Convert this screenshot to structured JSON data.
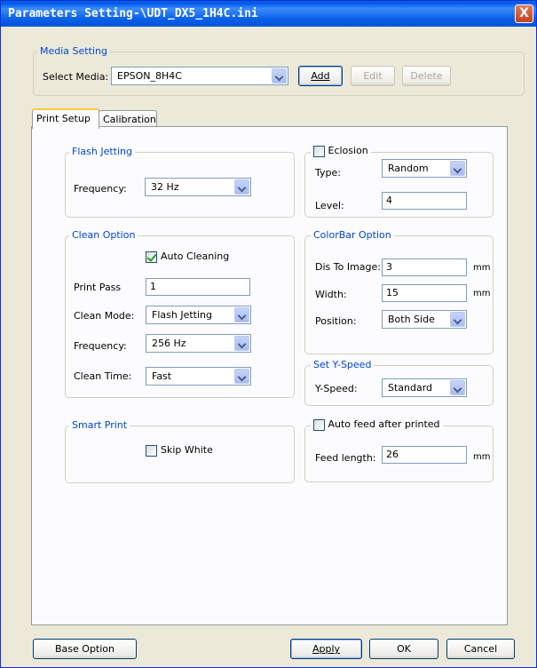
{
  "window": {
    "title": "Parameters Setting-\\UDT_DX5_1H4C.ini",
    "close_label": "X"
  },
  "media_setting": {
    "legend": "Media Setting",
    "select_label": "Select Media:",
    "selected_media": "EPSON_8H4C",
    "add_label": "Add",
    "edit_label": "Edit",
    "delete_label": "Delete"
  },
  "tabs": [
    {
      "label": "Print Setup",
      "active": true
    },
    {
      "label": "Calibration",
      "active": false
    }
  ],
  "flash_jetting": {
    "legend": "Flash Jetting",
    "frequency_label": "Frequency:",
    "frequency_value": "32   Hz"
  },
  "eclosion": {
    "label": "Eclosion",
    "checked": false,
    "type_label": "Type:",
    "type_value": "Random",
    "level_label": "Level:",
    "level_value": "4"
  },
  "clean_option": {
    "legend": "Clean Option",
    "auto_cleaning_label": "Auto Cleaning",
    "auto_cleaning_checked": true,
    "print_pass_label": "Print Pass",
    "print_pass_value": "1",
    "clean_mode_label": "Clean Mode:",
    "clean_mode_value": "Flash Jetting",
    "frequency_label": "Frequency:",
    "frequency_value": "256  Hz",
    "clean_time_label": "Clean Time:",
    "clean_time_value": "Fast"
  },
  "colorbar_option": {
    "legend": "ColorBar Option",
    "dis_label": "Dis To Image:",
    "dis_value": "3",
    "dis_unit": "mm",
    "width_label": "Width:",
    "width_value": "15",
    "width_unit": "mm",
    "position_label": "Position:",
    "position_value": "Both Side"
  },
  "y_speed": {
    "legend": "Set Y-Speed",
    "label": "Y-Speed:",
    "value": "Standard"
  },
  "smart_print": {
    "legend": "Smart Print",
    "skip_white_label": "Skip White",
    "skip_white_checked": false
  },
  "auto_feed": {
    "label": "Auto feed after printed",
    "checked": false,
    "feed_length_label": "Feed length:",
    "feed_length_value": "26",
    "unit": "mm"
  },
  "footer": {
    "base_option_label": "Base Option",
    "apply_label": "Apply",
    "ok_label": "OK",
    "cancel_label": "Cancel"
  }
}
